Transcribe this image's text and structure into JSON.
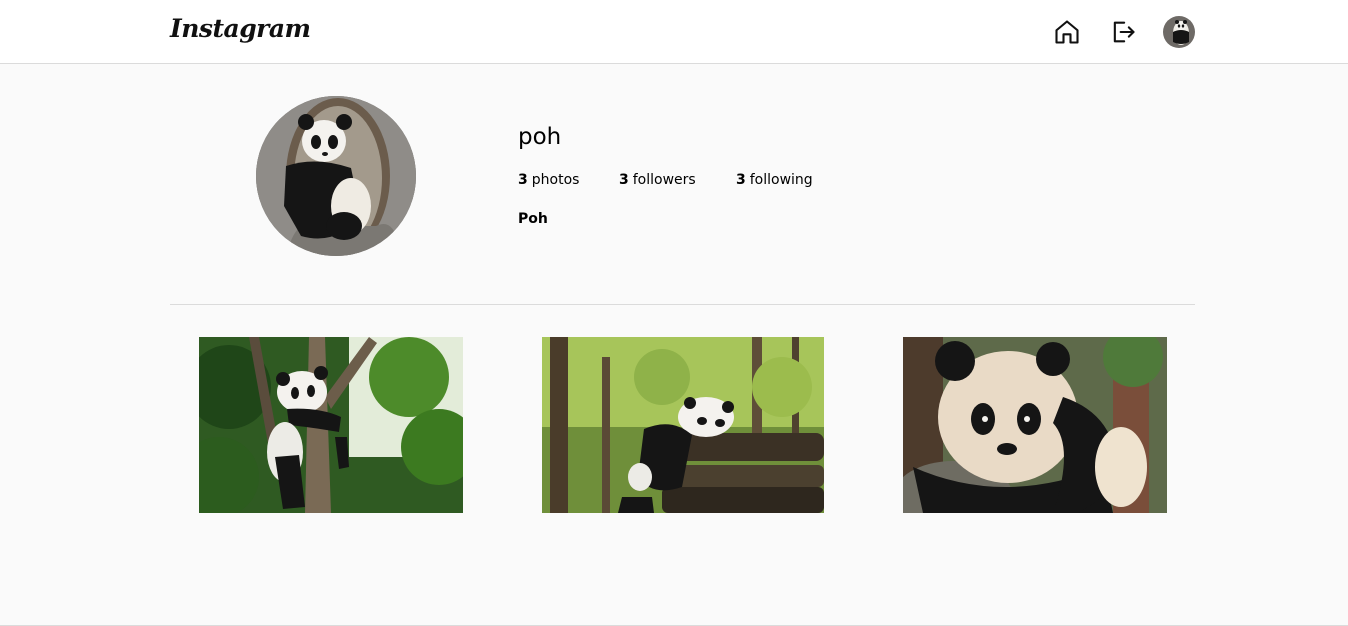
{
  "header": {
    "logo": "Instagram",
    "icons": {
      "home": "home-icon",
      "logout": "logout-icon",
      "avatar": "user-avatar"
    }
  },
  "profile": {
    "username": "poh",
    "full_name": "Poh",
    "stats": {
      "photos": {
        "count": "3",
        "label": "photos"
      },
      "followers": {
        "count": "3",
        "label": "followers"
      },
      "following": {
        "count": "3",
        "label": "following"
      }
    }
  },
  "colors": {
    "background": "#fafafa",
    "header_bg": "#ffffff",
    "divider": "#dbdbdb",
    "text": "#000000"
  }
}
